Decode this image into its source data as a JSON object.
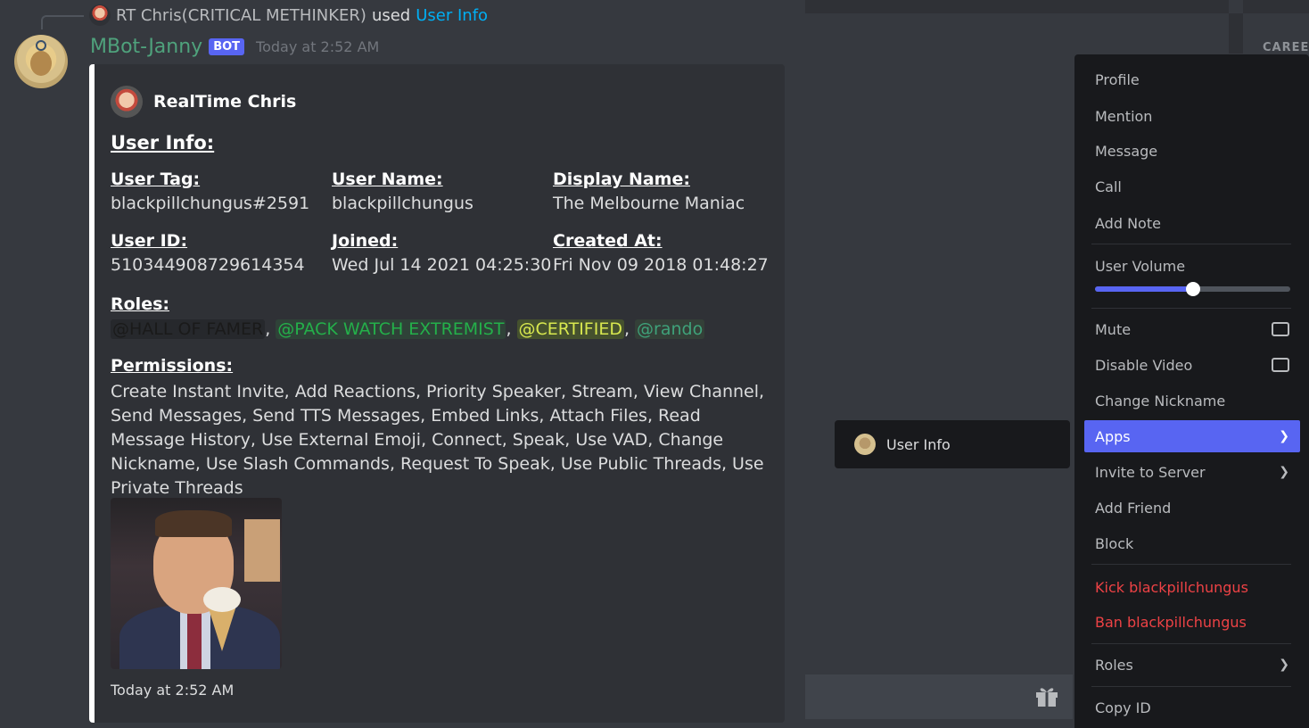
{
  "reply": {
    "user": "RT Chris(CRITICAL METHINKER)",
    "used": "used",
    "command": "User Info"
  },
  "message": {
    "author": "MBot-Janny",
    "bot_tag": "BOT",
    "timestamp": "Today at 2:52 AM"
  },
  "embed": {
    "author": "RealTime Chris",
    "title": "User Info:",
    "fields": [
      {
        "name": "User Tag:",
        "value": "blackpillchungus#2591"
      },
      {
        "name": "User Name:",
        "value": "blackpillchungus"
      },
      {
        "name": "Display Name:",
        "value": "The Melbourne Maniac"
      },
      {
        "name": "User ID:",
        "value": "510344908729614354"
      },
      {
        "name": "Joined:",
        "value": "Wed Jul 14 2021 04:25:30"
      },
      {
        "name": "Created At:",
        "value": "Fri Nov 09 2018 01:48:27"
      }
    ],
    "roles_label": "Roles:",
    "roles": [
      "@HALL OF FAMER",
      "@PACK WATCH EXTREMIST",
      "@CERTIFIED",
      "@rando"
    ],
    "role_separator": ",",
    "permissions_label": "Permissions:",
    "permissions": "Create Instant Invite, Add Reactions, Priority Speaker, Stream, View Channel, Send Messages, Send TTS Messages, Embed Links, Attach Files, Read Message History, Use External Emoji, Connect, Speak, Use VAD, Change Nickname, Use Slash Commands, Request To Speak, Use Public Threads, Use Private Threads",
    "footer": "Today at 2:52 AM"
  },
  "background": {
    "section_label": "CAREE"
  },
  "submenu": {
    "label": "User Info"
  },
  "context_menu": {
    "items": {
      "profile": "Profile",
      "mention": "Mention",
      "message": "Message",
      "call": "Call",
      "add_note": "Add Note",
      "user_volume": "User Volume",
      "mute": "Mute",
      "disable_video": "Disable Video",
      "change_nickname": "Change Nickname",
      "apps": "Apps",
      "invite": "Invite to Server",
      "add_friend": "Add Friend",
      "block": "Block",
      "kick": "Kick blackpillchungus",
      "ban": "Ban blackpillchungus",
      "roles": "Roles",
      "copy_id": "Copy ID"
    },
    "volume_level": 0.5
  },
  "colors": {
    "accent": "#5865f2",
    "danger": "#ed4245",
    "bot_name": "#4fa27c",
    "link": "#00aff4"
  }
}
